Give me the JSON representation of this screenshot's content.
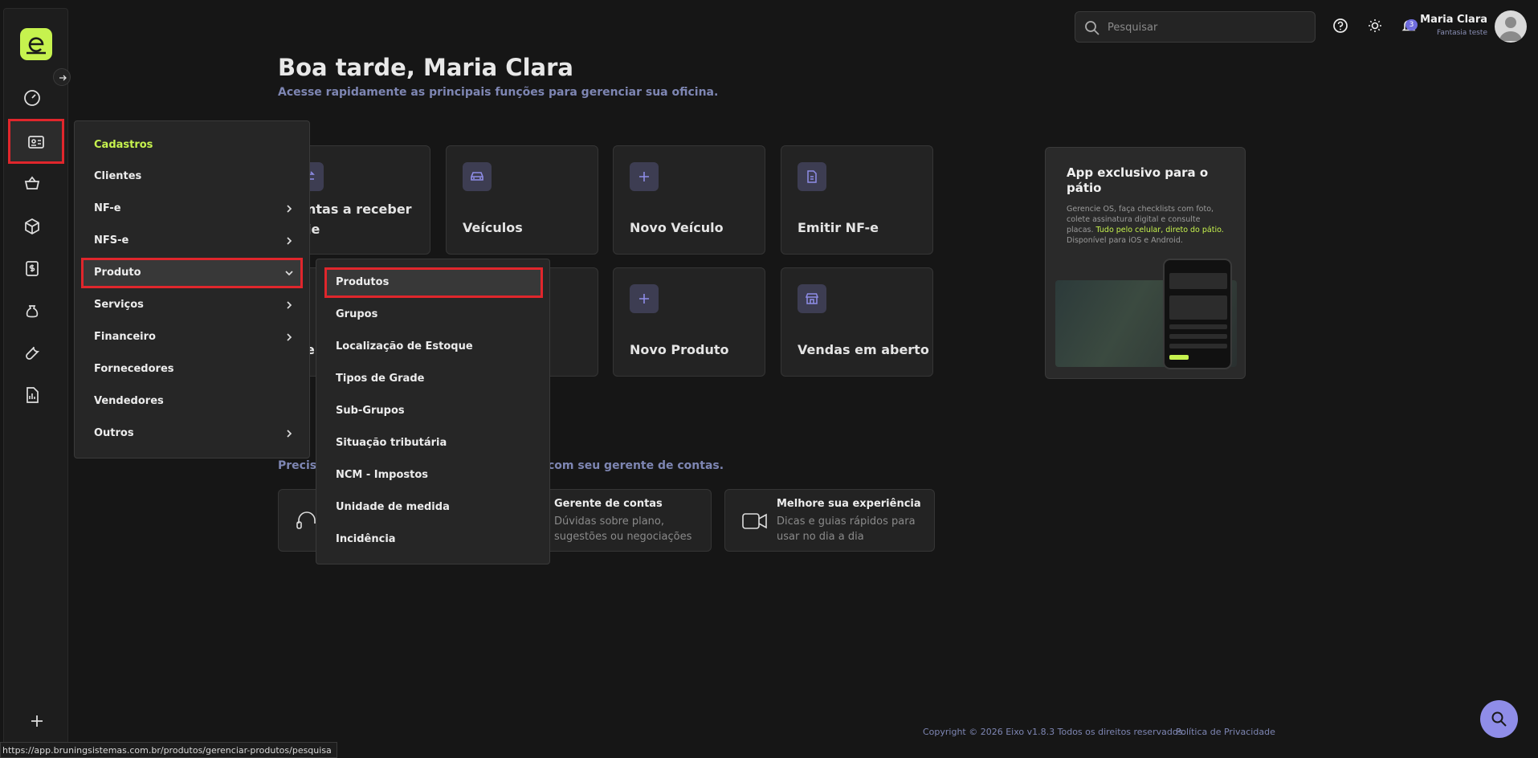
{
  "header": {
    "search_placeholder": "Pesquisar",
    "notification_count": "3",
    "user_name": "Maria Clara",
    "user_company": "Fantasia teste"
  },
  "main": {
    "greeting": "Boa tarde, Maria Clara",
    "subtitle": "Acesse rapidamente as principais funções para gerenciar sua oficina.",
    "cards": [
      {
        "label": "Contas a receber hoje",
        "icon": "money-transfer-icon"
      },
      {
        "label": "Veículos",
        "icon": "car-icon"
      },
      {
        "label": "Novo Veículo",
        "icon": "plus-icon"
      },
      {
        "label": "Emitir NF-e",
        "icon": "document-icon"
      },
      {
        "label": "Novo Produto",
        "icon": "plus-icon"
      },
      {
        "label": "Vendas em aberto",
        "icon": "store-icon"
      }
    ],
    "partial_card_1": "ntas a receber",
    "partial_card_2": "je",
    "partial_card_3": "e"
  },
  "promo": {
    "title": "App exclusivo para o pátio",
    "text_1": "Gerencie OS, faça checklists com foto, colete assinatura digital e consulte placas. ",
    "text_highlight": "Tudo pelo celular, direto do pátio.",
    "text_2": " Disponível para iOS e Android."
  },
  "support": {
    "title_pre": "Precisa",
    "title_post": "com seu gerente de contas.",
    "cards": [
      {
        "title": "Gerente de contas",
        "desc": "Dúvidas sobre plano, sugestões ou negociações"
      },
      {
        "title": "Melhore sua experiência",
        "desc": "Dicas e guias rápidos para usar no dia a dia"
      }
    ]
  },
  "menu": {
    "header": "Cadastros",
    "items": [
      "Clientes",
      "NF-e",
      "NFS-e",
      "Produto",
      "Serviços",
      "Financeiro",
      "Fornecedores",
      "Vendedores",
      "Outros"
    ]
  },
  "submenu": {
    "items": [
      "Produtos",
      "Grupos",
      "Localização de Estoque",
      "Tipos de Grade",
      "Sub-Grupos",
      "Situação tributária",
      "NCM - Impostos",
      "Unidade de medida",
      "Incidência"
    ]
  },
  "footer": {
    "copyright": "Copyright © 2026 Eixo v1.8.3 Todos os direitos reservados.",
    "privacy": "Política de Privacidade"
  },
  "status_url": "https://app.bruningsistemas.com.br/produtos/gerenciar-produtos/pesquisa",
  "colors": {
    "accent": "#c6f24e",
    "highlight_border": "#e0262c",
    "muted_blue": "#7e86b3",
    "fab": "#8f8de8"
  }
}
